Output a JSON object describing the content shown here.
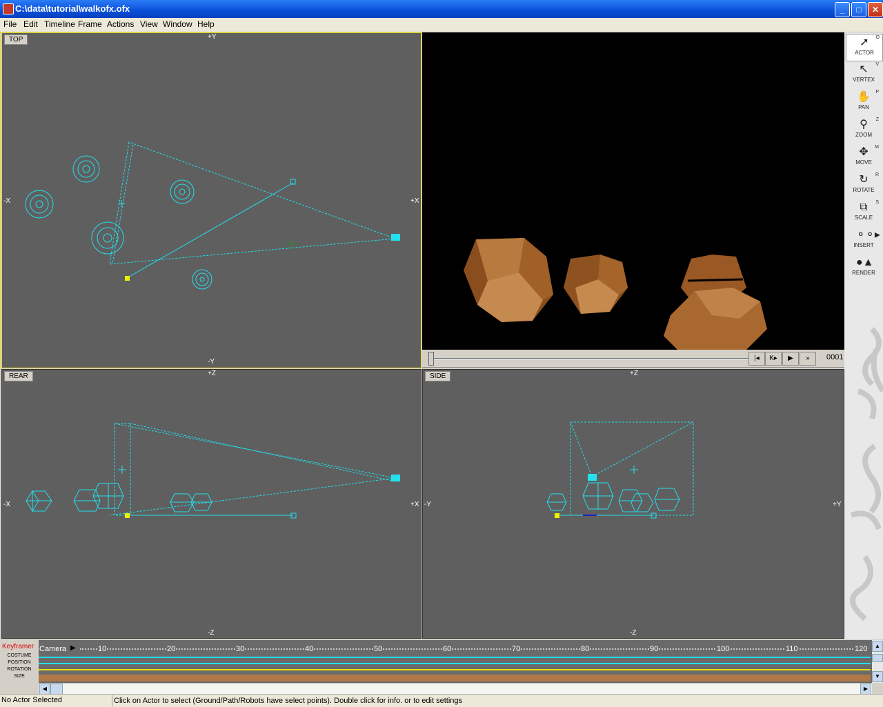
{
  "window": {
    "title": "C:\\data\\tutorial\\walkofx.ofx",
    "min": "_",
    "max": "□",
    "close": "✕"
  },
  "menu": {
    "file": "File",
    "edit": "Edit",
    "timeline": "Timeline",
    "frame": "Frame",
    "actions": "Actions",
    "view": "View",
    "window": "Window",
    "help": "Help"
  },
  "viewports": {
    "top": {
      "label": "TOP",
      "ptop": "+Y",
      "pbottom": "-Y",
      "pleft": "-X",
      "pright": "+X"
    },
    "rear": {
      "label": "REAR",
      "ptop": "+Z",
      "pbottom": "-Z",
      "pleft": "-X",
      "pright": "+X"
    },
    "side": {
      "label": "SIDE",
      "ptop": "+Z",
      "pbottom": "-Z",
      "pleft": "-Y",
      "pright": "+Y"
    }
  },
  "playback": {
    "first": "|◂",
    "prev": "K▸",
    "play": "▶",
    "last": "»",
    "frame": "0001"
  },
  "tools": [
    {
      "label": "ACTOR",
      "key": "O",
      "icon": "arrow-icon"
    },
    {
      "label": "VERTEX",
      "key": "V",
      "icon": "vertex-arrow-icon"
    },
    {
      "label": "PAN",
      "key": "P",
      "icon": "hand-icon"
    },
    {
      "label": "ZOOM",
      "key": "Z",
      "icon": "magnifier-icon"
    },
    {
      "label": "MOVE",
      "key": "M",
      "icon": "move-icon"
    },
    {
      "label": "ROTATE",
      "key": "R",
      "icon": "rotate-icon"
    },
    {
      "label": "SCALE",
      "key": "S",
      "icon": "scale-icon"
    },
    {
      "label": "INSERT",
      "key": "",
      "icon": "insert-icon"
    },
    {
      "label": "RENDER",
      "key": "",
      "icon": "render-icon"
    }
  ],
  "keyframer": {
    "title": "Keyframer",
    "rows": [
      "COSTUME",
      "POSITION",
      "ROTATION",
      "SIZE"
    ],
    "track": "Camera",
    "ticks": [
      "10",
      "20",
      "30",
      "40",
      "50",
      "60",
      "70",
      "80",
      "90",
      "100",
      "110",
      "120"
    ]
  },
  "status": {
    "selection": "No Actor Selected",
    "hint": "Click on Actor to select  (Ground/Path/Robots have select points). Double click for info. or to edit settings"
  },
  "colors": {
    "wire": "#22e0ee",
    "viewport": "#5f5f5f",
    "object": "#b06a30"
  }
}
